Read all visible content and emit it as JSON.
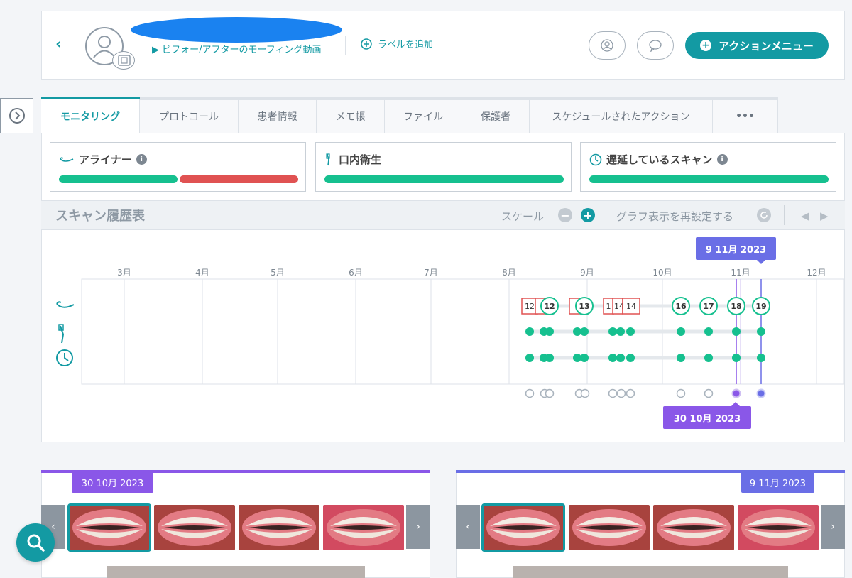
{
  "header": {
    "subtitle": "▶ ビフォー/アフターのモーフィング動画",
    "add_label": "ラベルを追加",
    "action_menu": "アクションメニュー"
  },
  "tabs": [
    {
      "label": "モニタリング",
      "active": true
    },
    {
      "label": "プロトコール"
    },
    {
      "label": "患者情報"
    },
    {
      "label": "メモ帳"
    },
    {
      "label": "ファイル"
    },
    {
      "label": "保護者"
    },
    {
      "label": "スケジュールされたアクション"
    },
    {
      "label": "•••"
    }
  ],
  "metrics": [
    {
      "title": "アライナー",
      "info": "i",
      "green_fraction": 0.5,
      "red_fraction": 0.5
    },
    {
      "title": "口内衛生",
      "green_fraction": 1.0
    },
    {
      "title": "遅延しているスキャン",
      "info": "i",
      "green_fraction": 1.0
    }
  ],
  "scan_history": {
    "title": "スキャン履歴表",
    "scale_label": "スケール",
    "reset_label": "グラフ表示を再設定する",
    "months": [
      "3月",
      "4月",
      "5月",
      "6月",
      "7月",
      "8月",
      "9月",
      "10月",
      "11月",
      "12月"
    ],
    "aligner_labels": [
      "12",
      "12",
      "1",
      "13",
      "1",
      "14",
      "14",
      "16",
      "17",
      "18",
      "19"
    ],
    "flag_top": "9 11月 2023",
    "flag_bottom": "30 10月 2023"
  },
  "bottom": {
    "left_date": "30 10月 2023",
    "right_date": "9 11月 2023",
    "prev": "‹",
    "next": "›"
  },
  "colors": {
    "teal": "#139aa3",
    "green": "#16c08f",
    "red": "#e05252",
    "purple": "#8a57e8",
    "blue_purple": "#6a6ee6"
  }
}
